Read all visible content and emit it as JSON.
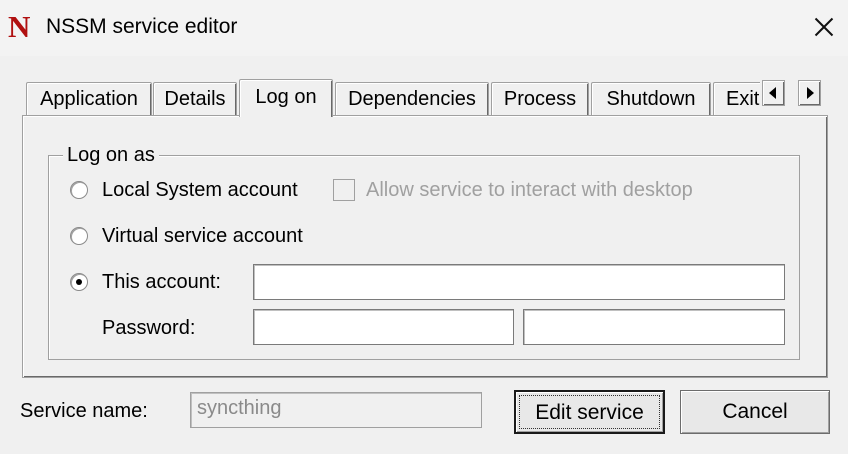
{
  "window": {
    "title": "NSSM service editor",
    "app_icon_letter": "N"
  },
  "tabs": [
    {
      "label": "Application",
      "active": false
    },
    {
      "label": "Details",
      "active": false
    },
    {
      "label": "Log on",
      "active": true
    },
    {
      "label": "Dependencies",
      "active": false
    },
    {
      "label": "Process",
      "active": false
    },
    {
      "label": "Shutdown",
      "active": false
    },
    {
      "label": "Exit",
      "active": false
    }
  ],
  "logon": {
    "group_label": "Log on as",
    "local_system_label": "Local System account",
    "interact_desktop_label": "Allow service to interact with desktop",
    "virtual_account_label": "Virtual service account",
    "this_account_label": "This account:",
    "this_account_value": "",
    "password_label": "Password:",
    "password_value": "",
    "password_confirm_value": "",
    "selected": "this_account"
  },
  "footer": {
    "service_name_label": "Service name:",
    "service_name_value": "syncthing",
    "edit_button": "Edit service",
    "cancel_button": "Cancel"
  }
}
